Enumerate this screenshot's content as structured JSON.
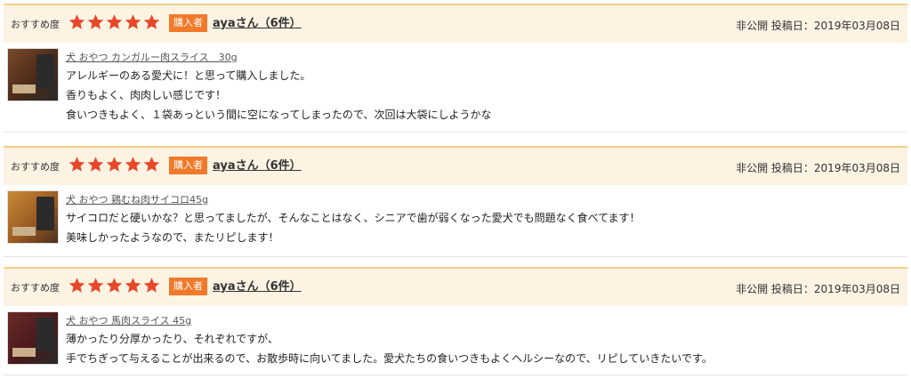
{
  "reviews": [
    {
      "recommend_label": "おすすめ度",
      "rating": 5,
      "badge": "購入者",
      "reviewer": "ayaさん（6件）",
      "meta": "非公開 投稿日：2019年03月08日",
      "product": "犬 おやつ カンガルー肉スライス　30g",
      "thumbnail": "kangaroo-jerky",
      "lines": [
        "アレルギーのある愛犬に！と思って購入しました。",
        "香りもよく、肉肉しい感じです！",
        "食いつきもよく、１袋あっという間に空になってしまったので、次回は大袋にしようかな"
      ]
    },
    {
      "recommend_label": "おすすめ度",
      "rating": 5,
      "badge": "購入者",
      "reviewer": "ayaさん（6件）",
      "meta": "非公開 投稿日：2019年03月08日",
      "product": "犬 おやつ 鶏むね肉サイコロ45g",
      "thumbnail": "chicken-cubes",
      "lines": [
        "サイコロだと硬いかな？と思ってましたが、そんなことはなく、シニアで歯が弱くなった愛犬でも問題なく食べてます！",
        "美味しかったようなので、またリピします！"
      ]
    },
    {
      "recommend_label": "おすすめ度",
      "rating": 5,
      "badge": "購入者",
      "reviewer": "ayaさん（6件）",
      "meta": "非公開 投稿日：2019年03月08日",
      "product": "犬 おやつ 馬肉スライス 45g",
      "thumbnail": "horse-meat-slices",
      "lines": [
        "薄かったり分厚かったり、それぞれですが、",
        "手でちぎって与えることが出来るので、お散歩時に向いてました。愛犬たちの食いつきもよくヘルシーなので、リピしていきたいです。"
      ]
    }
  ],
  "colors": {
    "header_bg": "#fdf3e3",
    "header_border": "#f3cf88",
    "star": "#e8482a",
    "badge": "#f07a2a"
  }
}
